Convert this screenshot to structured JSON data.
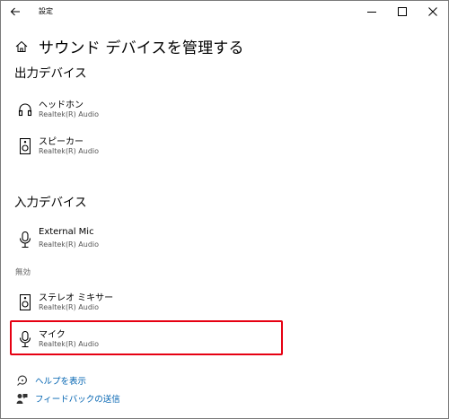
{
  "window": {
    "title": "設定",
    "back_icon": "back-arrow-icon",
    "controls": [
      "minimize-icon",
      "maximize-icon",
      "close-icon"
    ]
  },
  "page": {
    "title": "サウンド デバイスを管理する",
    "home_icon": "home-icon"
  },
  "output_section": {
    "heading": "出力デバイス",
    "devices": [
      {
        "name": "ヘッドホン",
        "driver": "Realtek(R) Audio",
        "icon": "headphones-icon"
      },
      {
        "name": "スピーカー",
        "driver": "Realtek(R) Audio",
        "icon": "speaker-icon"
      }
    ]
  },
  "input_section": {
    "heading": "入力デバイス",
    "devices": [
      {
        "name": "External Mic",
        "driver": "Realtek(R) Audio",
        "icon": "microphone-icon"
      }
    ],
    "disabled_label": "無効",
    "disabled_devices": [
      {
        "name": "ステレオ ミキサー",
        "driver": "Realtek(R) Audio",
        "icon": "speaker-icon"
      },
      {
        "name": "マイク",
        "driver": "Realtek(R) Audio",
        "icon": "microphone-icon",
        "highlighted": true
      }
    ]
  },
  "links": [
    {
      "label": "ヘルプを表示",
      "icon": "help-icon"
    },
    {
      "label": "フィードバックの送信",
      "icon": "feedback-icon"
    }
  ],
  "colors": {
    "link": "#0063b1",
    "highlight_border": "#e60012",
    "secondary_text": "#555555"
  }
}
